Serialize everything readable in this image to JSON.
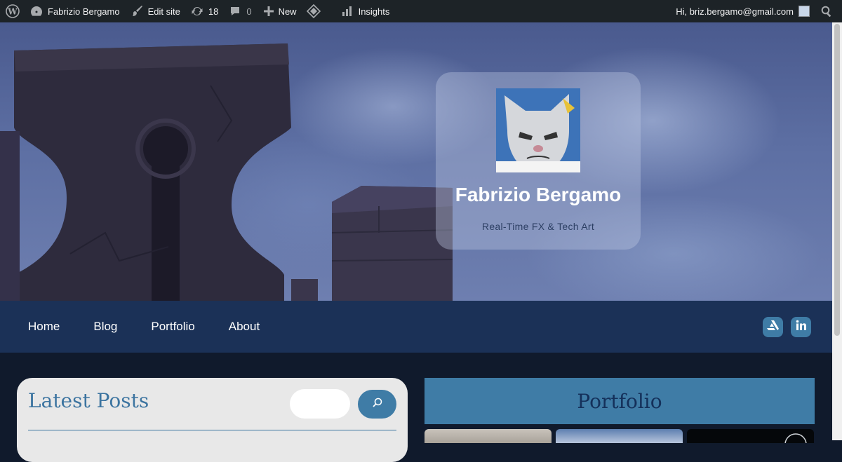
{
  "adminbar": {
    "wp_logo_icon": "wordpress-icon",
    "site_name": "Fabrizio Bergamo",
    "edit_site": "Edit site",
    "updates_count": "18",
    "comments_count": "0",
    "new_label": "New",
    "insights_label": "Insights",
    "greeting": "Hi, briz.bergamo@gmail.com"
  },
  "hero": {
    "site_title": "Fabrizio Bergamo",
    "tagline": "Real-Time FX & Tech Art"
  },
  "nav": {
    "items": [
      {
        "label": "Home"
      },
      {
        "label": "Blog"
      },
      {
        "label": "Portfolio"
      },
      {
        "label": "About"
      }
    ],
    "social": [
      {
        "icon": "artstation-icon"
      },
      {
        "icon": "linkedin-icon"
      }
    ]
  },
  "latest": {
    "title": "Latest Posts",
    "search_placeholder": ""
  },
  "portfolio": {
    "title": "Portfolio"
  },
  "colors": {
    "adminbar": "#1d2327",
    "nav": "#1b3157",
    "accent": "#3f7ca6",
    "content_bg": "#101a2c"
  }
}
